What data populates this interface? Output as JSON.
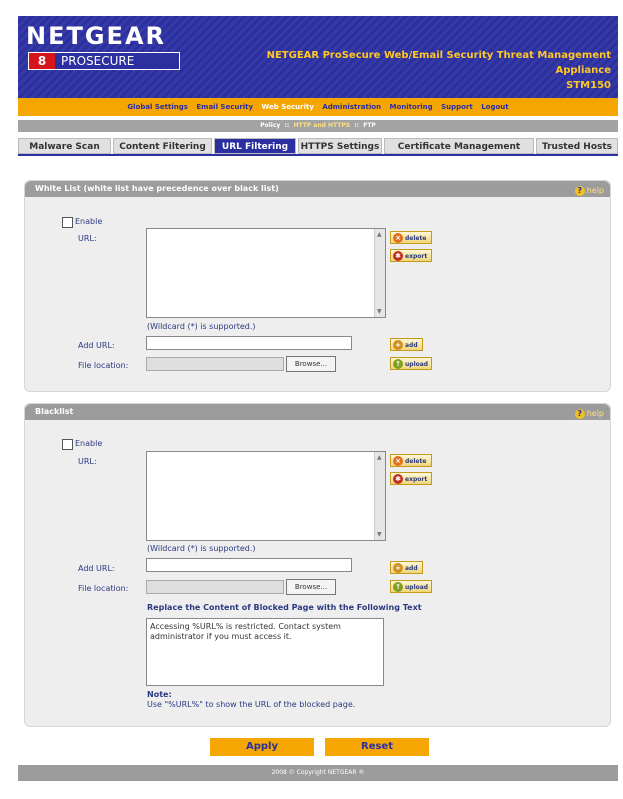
{
  "header": {
    "logo": "NETGEAR",
    "logo_badge": "8",
    "logo_sub": "PROSECURE",
    "product_name": "NETGEAR ProSecure Web/Email Security Threat Management Appliance",
    "model": "STM150"
  },
  "nav": {
    "items": [
      "Global Settings",
      "Email Security",
      "Web Security",
      "Administration",
      "Monitoring",
      "Support",
      "Logout"
    ],
    "active": "Web Security"
  },
  "subnav": {
    "items": [
      "Policy",
      "HTTP and HTTPS",
      "FTP"
    ],
    "active": "HTTP and HTTPS"
  },
  "tabs": [
    "Malware Scan",
    "Content Filtering",
    "URL Filtering",
    "HTTPS Settings",
    "Certificate Management",
    "Trusted Hosts"
  ],
  "active_tab": "URL Filtering",
  "whitelist": {
    "title": "White List (white list have precedence over black list)",
    "help": "help",
    "enable_label": "Enable",
    "url_label": "URL:",
    "delete_label": "delete",
    "export_label": "export",
    "wildcard_hint": "(Wildcard (*) is supported.)",
    "add_url_label": "Add URL:",
    "add_label": "add",
    "file_location_label": "File location:",
    "browse_label": "Browse...",
    "upload_label": "upload"
  },
  "blacklist": {
    "title": "Blacklist",
    "help": "help",
    "enable_label": "Enable",
    "url_label": "URL:",
    "delete_label": "delete",
    "export_label": "export",
    "wildcard_hint": "(Wildcard (*) is supported.)",
    "add_url_label": "Add URL:",
    "add_label": "add",
    "file_location_label": "File location:",
    "browse_label": "Browse...",
    "upload_label": "upload",
    "replace_heading": "Replace the Content of Blocked Page with the Following Text",
    "replace_text": "Accessing %URL% is restricted.  Contact system administrator if you must access it.",
    "note_title": "Note:",
    "note_text": "Use \"%URL%\" to show the URL of the blocked page."
  },
  "actions": {
    "apply": "Apply",
    "reset": "Reset"
  },
  "footer": "2008 © Copyright NETGEAR ®",
  "colors": {
    "brand_blue": "#2b2fa0",
    "nav_orange": "#f5a602",
    "panel_gray": "#9c9c9c"
  }
}
